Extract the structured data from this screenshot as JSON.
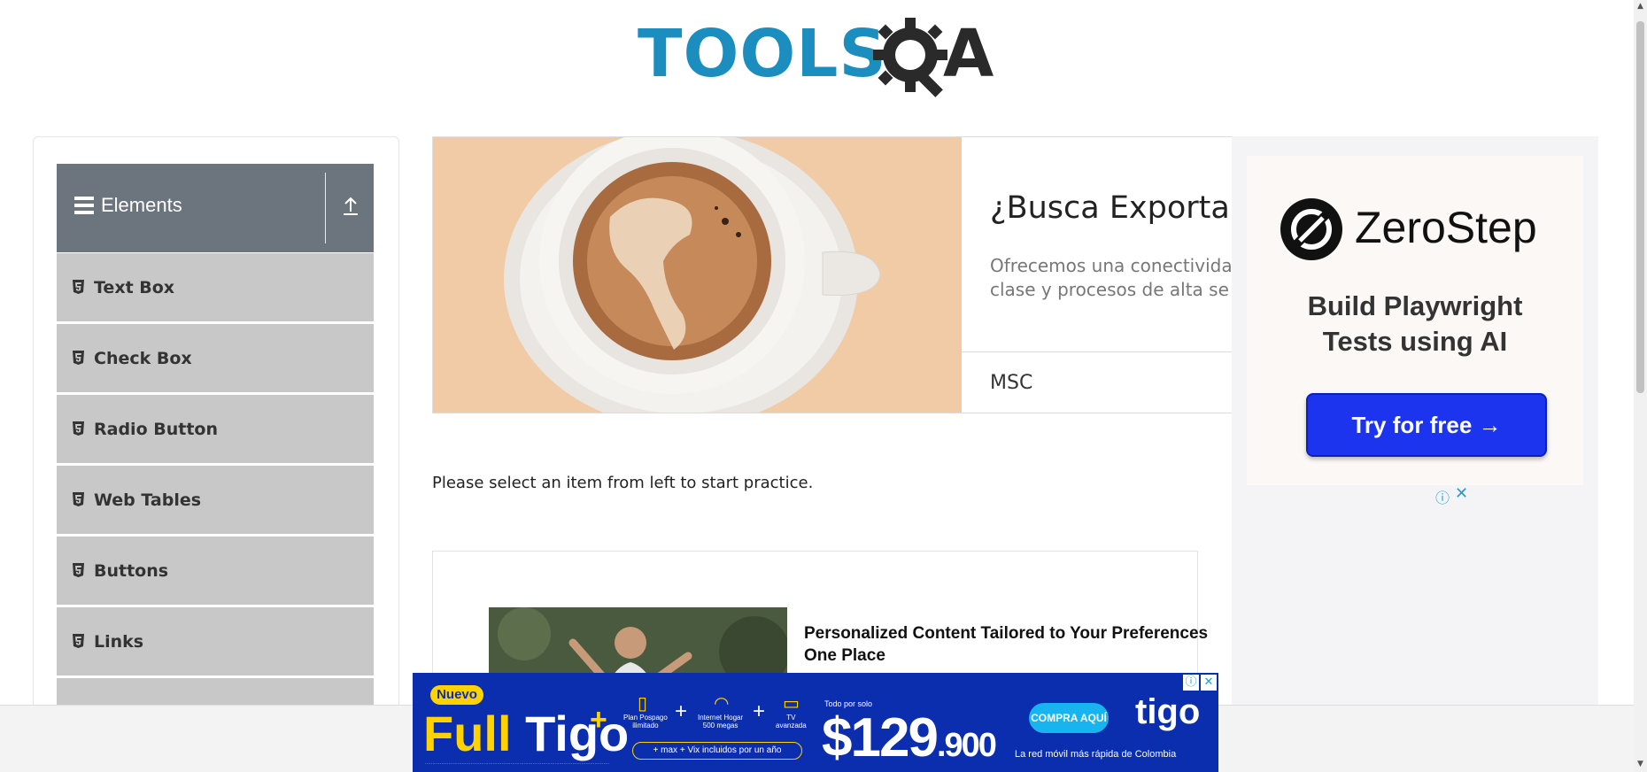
{
  "header": {
    "logo_text_1": "TOOLS",
    "logo_text_2": "A"
  },
  "sidebar": {
    "group_title": "Elements",
    "items": [
      {
        "label": "Text Box"
      },
      {
        "label": "Check Box"
      },
      {
        "label": "Radio Button"
      },
      {
        "label": "Web Tables"
      },
      {
        "label": "Buttons"
      },
      {
        "label": "Links"
      }
    ]
  },
  "banner_ad": {
    "headline": "¿Busca Exportar",
    "body": "Ofrecemos una conectivida\nclase y procesos de alta se",
    "advertiser": "MSC"
  },
  "main": {
    "instruction": "Please select an item from left to start practice."
  },
  "recommendation": {
    "title": "Personalized Content Tailored to Your Preferences\nOne Place"
  },
  "right_ad": {
    "brand": "ZeroStep",
    "tagline": "Build Playwright\nTests using AI",
    "button": "Try for free →"
  },
  "bottom_ad": {
    "badge": "Nuevo",
    "product_full": "Full",
    "product_tigo": "Tigo",
    "plus": "+",
    "feature_1": "Plan Pospago\nilimitado",
    "feature_2": "Internet Hogar\n500 megas",
    "feature_3": "TV\navanzada",
    "bundle": "+ max + Vix incluidos por un año",
    "price_prefix": "Todo por solo",
    "price_main": "$129",
    "price_cents": ".900",
    "cta": "COMPRA AQUÍ",
    "brand": "tigo",
    "brand_tagline": "La red móvil más rápida de Colombia"
  },
  "colors": {
    "logo_blue": "#1b8ebf",
    "sidebar_header": "#6c757d",
    "menu_item": "#c8c8c8",
    "zerostep_button": "#1d34ef",
    "tigo_blue": "#0b2eae"
  }
}
